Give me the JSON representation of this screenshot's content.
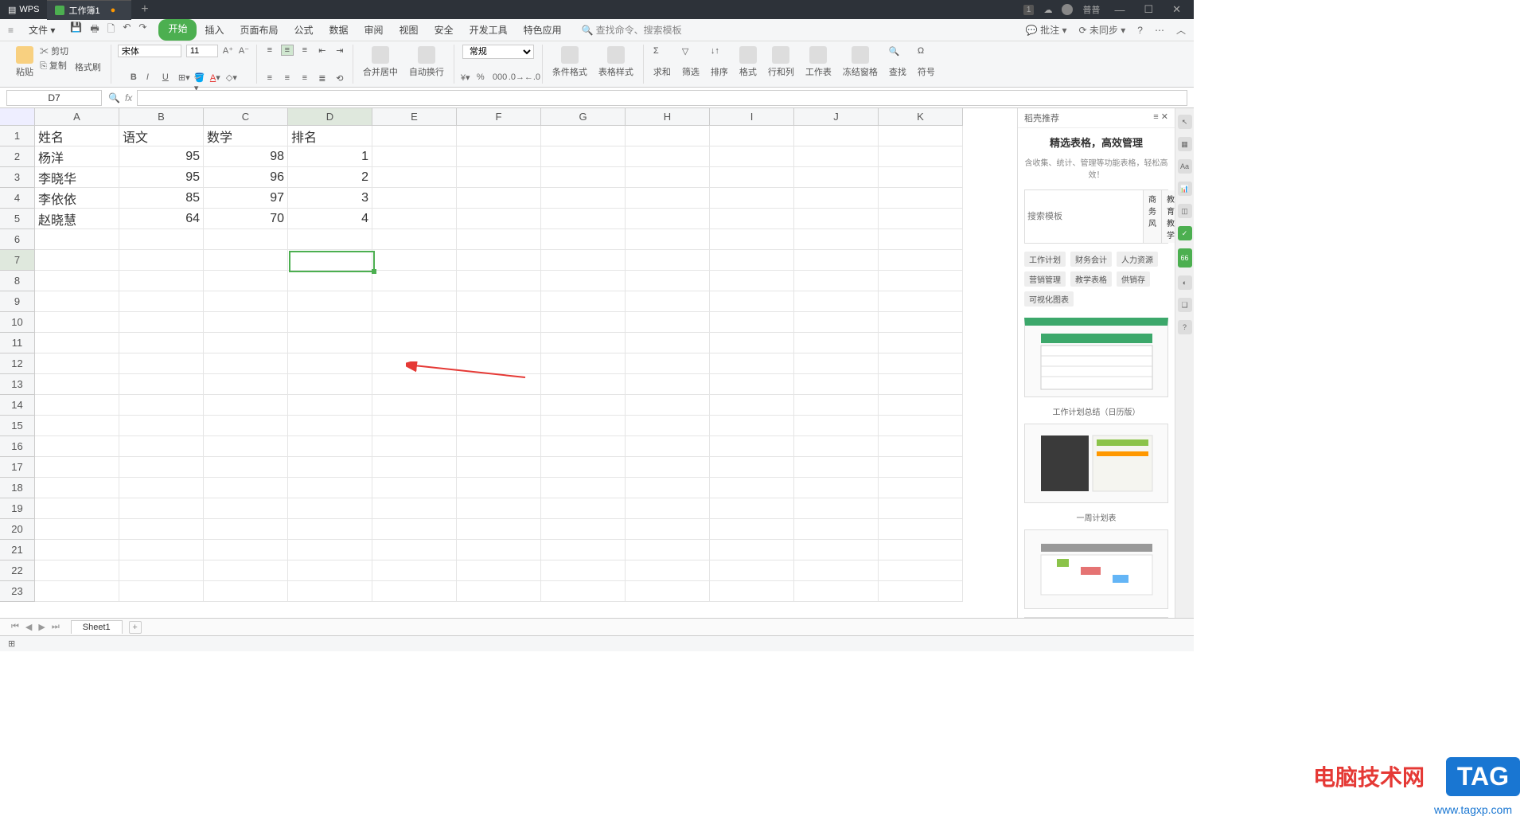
{
  "titlebar": {
    "app": "WPS",
    "workbook": "工作簿1",
    "badge": "1",
    "user": "普普"
  },
  "menubar": {
    "file": "文件",
    "tabs": [
      "开始",
      "插入",
      "页面布局",
      "公式",
      "数据",
      "审阅",
      "视图",
      "安全",
      "开发工具",
      "特色应用"
    ],
    "search_hint": "查找命令、搜索模板",
    "comments": "批注",
    "sync": "未同步"
  },
  "ribbon": {
    "paste": "粘贴",
    "cut": "剪切",
    "copy": "复制",
    "format_painter": "格式刷",
    "font_name": "宋体",
    "font_size": "11",
    "merge_center": "合并居中",
    "wrap_text": "自动换行",
    "number_format": "常规",
    "cond_format": "条件格式",
    "table_style": "表格样式",
    "sum": "求和",
    "filter": "筛选",
    "sort": "排序",
    "format": "格式",
    "rows_cols": "行和列",
    "worksheet": "工作表",
    "freeze": "冻结窗格",
    "find": "查找",
    "symbol": "符号"
  },
  "namebox": "D7",
  "columns": [
    "A",
    "B",
    "C",
    "D",
    "E",
    "F",
    "G",
    "H",
    "I",
    "J",
    "K"
  ],
  "rows_numbers": [
    "1",
    "2",
    "3",
    "4",
    "5",
    "6",
    "7",
    "8",
    "9",
    "10",
    "11",
    "12",
    "13",
    "14",
    "15",
    "16",
    "17",
    "18",
    "19",
    "20",
    "21",
    "22",
    "23"
  ],
  "data": {
    "r1": {
      "A": "姓名",
      "B": "语文",
      "C": "数学",
      "D": "排名"
    },
    "r2": {
      "A": "杨洋",
      "B": "95",
      "C": "98",
      "D": "1"
    },
    "r3": {
      "A": "李晓华",
      "B": "95",
      "C": "96",
      "D": "2"
    },
    "r4": {
      "A": "李依依",
      "B": "85",
      "C": "97",
      "D": "3"
    },
    "r5": {
      "A": "赵晓慧",
      "B": "64",
      "C": "70",
      "D": "4"
    }
  },
  "sheet_tab": "Sheet1",
  "panel": {
    "header": "稻壳推荐",
    "title": "精选表格，高效管理",
    "subtitle": "含收集、统计、管理等功能表格，轻松高效！",
    "search_placeholder": "搜索模板",
    "search_tabs": [
      "商务风",
      "教育教学"
    ],
    "tags": [
      "工作计划",
      "财务会计",
      "人力资源",
      "营销管理",
      "教学表格",
      "供销存",
      "可视化图表"
    ],
    "tpl1_label": "工作计划总结（日历版）",
    "tpl2_label": "一周计划表"
  },
  "side_counter": "66",
  "watermark": {
    "site": "电脑技术网",
    "url": "www.tagxp.com",
    "tag": "TAG"
  }
}
